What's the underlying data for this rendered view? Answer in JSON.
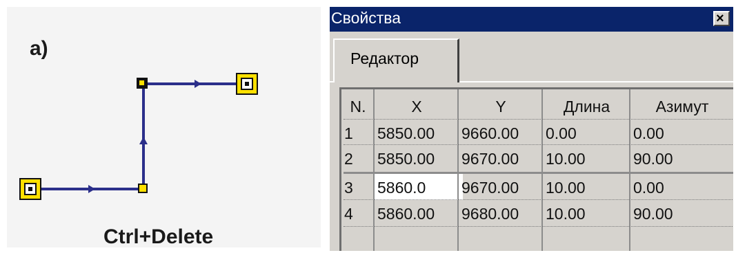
{
  "figure": {
    "caption": "а)",
    "shortcut": "Ctrl+Delete"
  },
  "colors": {
    "polyline": "#2b2f8a",
    "vertex_fill": "#ffe000",
    "titlebar": "#0a246a",
    "window_bg": "#d6d3ce"
  },
  "window": {
    "title": "Свойства",
    "close_icon": "close-icon",
    "close_glyph": "×"
  },
  "tabs": [
    {
      "label": "Редактор",
      "active": true
    }
  ],
  "grid": {
    "columns": [
      "N.",
      "X",
      "Y",
      "Длина",
      "Азимут"
    ],
    "rows": [
      [
        "1",
        "5850.00",
        "9660.00",
        "0.00",
        "0.00"
      ],
      [
        "2",
        "5850.00",
        "9670.00",
        "10.00",
        "90.00"
      ],
      [
        "3",
        "5860.0",
        "9670.00",
        "10.00",
        "0.00"
      ],
      [
        "4",
        "5860.00",
        "9680.00",
        "10.00",
        "90.00"
      ]
    ],
    "editing_row": 2,
    "editing_col": 1
  }
}
